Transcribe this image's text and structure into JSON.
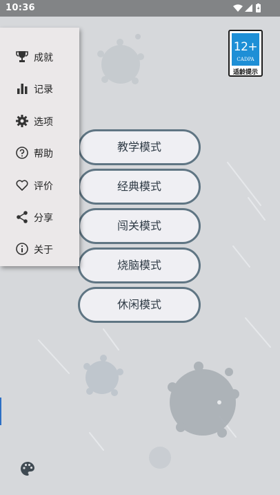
{
  "status_bar": {
    "time": "10:36"
  },
  "rating_badge": {
    "age": "12+",
    "org": "CADPA",
    "hint": "适龄提示"
  },
  "drawer": {
    "items": [
      {
        "label": "成就",
        "icon": "trophy-icon"
      },
      {
        "label": "记录",
        "icon": "bar-chart-icon"
      },
      {
        "label": "选项",
        "icon": "gear-icon"
      },
      {
        "label": "帮助",
        "icon": "help-circle-icon"
      },
      {
        "label": "评价",
        "icon": "heart-icon"
      },
      {
        "label": "分享",
        "icon": "share-icon"
      },
      {
        "label": "关于",
        "icon": "info-icon"
      }
    ]
  },
  "modes": [
    {
      "label": "教学模式"
    },
    {
      "label": "经典模式"
    },
    {
      "label": "闯关模式"
    },
    {
      "label": "烧脑模式"
    },
    {
      "label": "休闲模式"
    }
  ],
  "colors": {
    "background": "#d6d8db",
    "drawer": "#ebe8e9",
    "button_fill": "#efeff3",
    "button_border": "#5f7583",
    "status_bar": "#828486",
    "badge_blue": "#1e8fd6"
  }
}
